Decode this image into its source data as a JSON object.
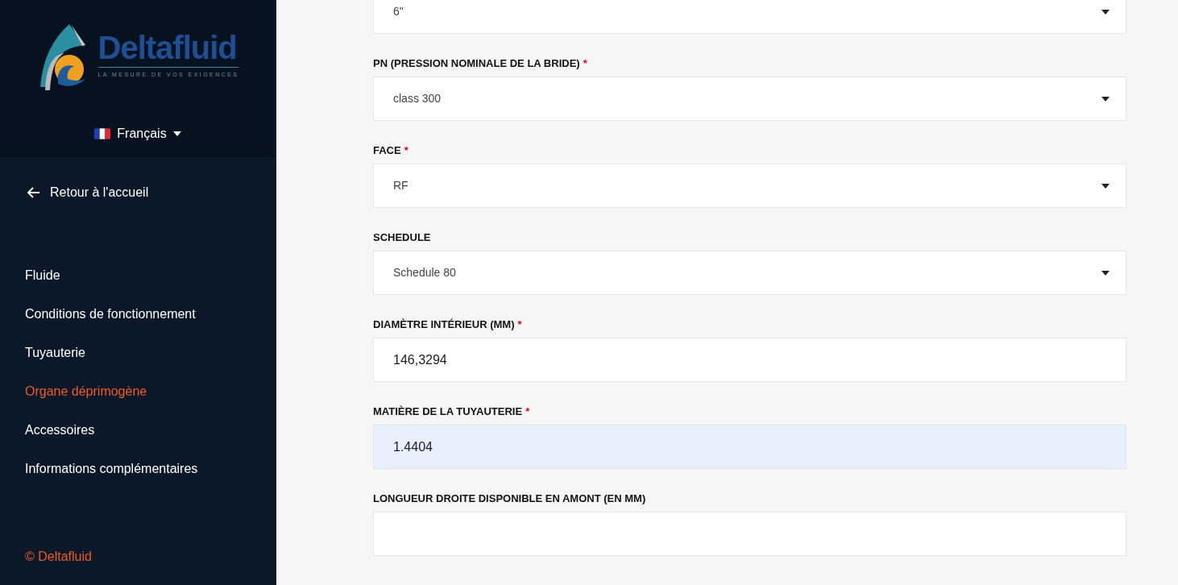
{
  "sidebar": {
    "logo": {
      "name": "Deltafluid",
      "tagline": "LA MESURE DE VOS EXIGENCES"
    },
    "language": {
      "label": "Français"
    },
    "back_link": "Retour à l'accueil",
    "nav": [
      {
        "label": "Fluide",
        "selected": false
      },
      {
        "label": "Conditions de fonctionnement",
        "selected": false
      },
      {
        "label": "Tuyauterie",
        "selected": false
      },
      {
        "label": "Organe déprimogène",
        "selected": true
      },
      {
        "label": "Accessoires",
        "selected": false
      },
      {
        "label": "Informations complémentaires",
        "selected": false
      }
    ],
    "footer": "© Deltafluid"
  },
  "form": {
    "fields": [
      {
        "kind": "select",
        "value": "6\""
      },
      {
        "kind": "select",
        "label": "PN (PRESSION NOMINALE DE LA BRIDE)",
        "required_mark": "*",
        "value": "class 300"
      },
      {
        "kind": "select",
        "label": "FACE",
        "required_mark": "*",
        "value": "RF"
      },
      {
        "kind": "select",
        "label": "SCHEDULE",
        "value": "Schedule 80"
      },
      {
        "kind": "input",
        "label": "DIAMÈTRE INTÉRIEUR (MM)",
        "required_mark": "*",
        "value": "146,3294",
        "autofilled": false
      },
      {
        "kind": "input",
        "label": "MATIÈRE DE LA TUYAUTERIE",
        "required_mark": "*",
        "value": "1.4404",
        "autofilled": true
      },
      {
        "kind": "input",
        "label": "LONGUEUR DROITE DISPONIBLE EN AMONT (EN MM)",
        "autofilled": false
      }
    ]
  }
}
